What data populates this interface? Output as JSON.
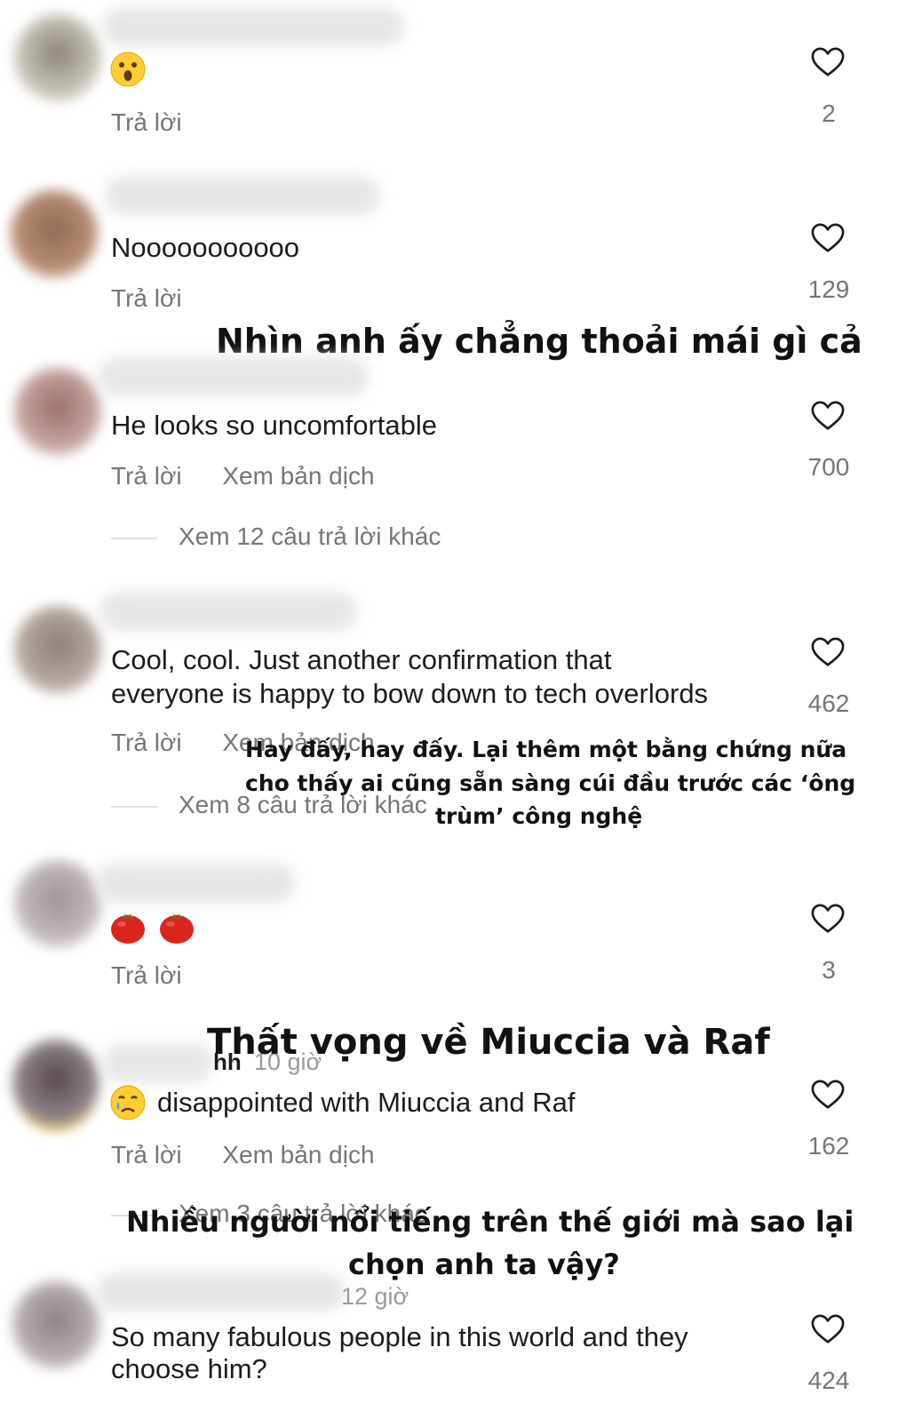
{
  "comments": [
    {
      "text": "",
      "reply": "Trả lời",
      "likes": "2"
    },
    {
      "text": "Nooooooooooo",
      "reply": "Trả lời",
      "likes": "129"
    },
    {
      "text": "He looks so uncomfortable",
      "reply": "Trả lời",
      "translate": "Xem bản dịch",
      "more_replies": "Xem 12 câu trả lời khác",
      "likes": "700"
    },
    {
      "text_line1": "Cool, cool. Just another confirmation that",
      "text_line2": "everyone is happy to bow down to tech overlords",
      "reply": "Trả lời",
      "translate": "Xem bản dịch",
      "more_replies": "Xem 8 câu trả lời khác",
      "likes": "462"
    },
    {
      "text": "",
      "reply": "Trả lời",
      "likes": "3"
    },
    {
      "name_tail": "hh",
      "time": "10 giờ",
      "text": "disappointed with Miuccia and Raf",
      "reply": "Trả lời",
      "translate": "Xem bản dịch",
      "more_replies": "Xem 3 câu trả lời khác",
      "likes": "162"
    },
    {
      "time": "12 giờ",
      "text_line1": "So many fabulous people in this world and they",
      "text_line2": "choose him?",
      "likes": "424"
    }
  ],
  "overlays": {
    "o1": "Nhìn anh ấy chẳng thoải mái gì cả",
    "o2_line1": "Hay đấy, hay đấy. Lại thêm một bằng chứng nữa",
    "o2_line2": "cho thấy ai cũng sẵn sàng cúi đầu trước các ‘ông",
    "o2_line3": "trùm’ công nghệ",
    "o3": "Thất vọng về Miuccia và Raf",
    "o4_line1": "Nhiều người nổi tiếng trên thế giới mà sao lại",
    "o4_line2": "chọn anh ta vậy?"
  },
  "icons": {
    "like": "heart-outline-icon",
    "emoji_surprised": "face-open-mouth-emoji",
    "emoji_tomato": "tomato-emoji",
    "emoji_crying": "crying-face-emoji"
  },
  "colors": {
    "text": "#1c1c1c",
    "secondary": "#767676",
    "background": "#ffffff"
  }
}
